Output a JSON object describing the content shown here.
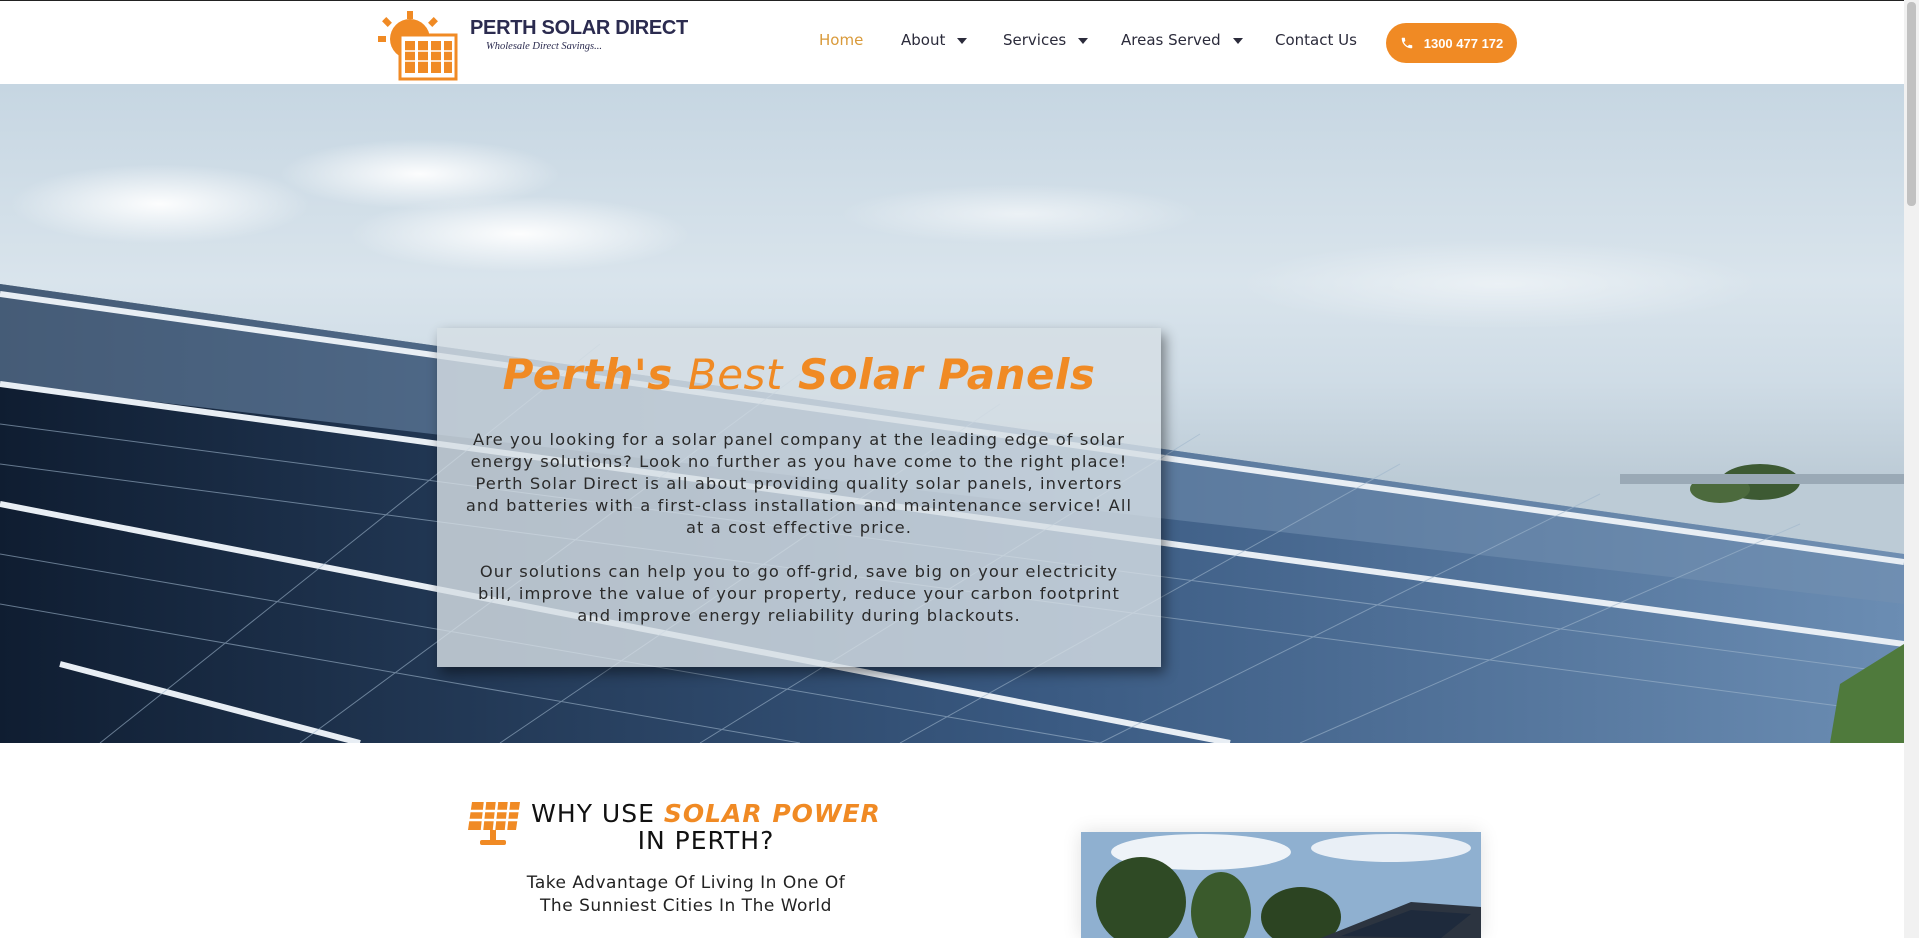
{
  "brand": {
    "name": "PERTH SOLAR DIRECT",
    "tagline": "Wholesale Direct Savings...",
    "accent_color": "#f08a24",
    "logo_icon": "sun-panel-logo-icon"
  },
  "nav": {
    "items": [
      {
        "label": "Home",
        "active": true,
        "dropdown": false
      },
      {
        "label": "About",
        "active": false,
        "dropdown": true
      },
      {
        "label": "Services",
        "active": false,
        "dropdown": true
      },
      {
        "label": "Areas Served",
        "active": false,
        "dropdown": true
      },
      {
        "label": "Contact Us",
        "active": false,
        "dropdown": false
      }
    ],
    "phone": {
      "label": "1300 477 172",
      "icon": "phone-icon"
    }
  },
  "hero": {
    "title_part1": "Perth's",
    "title_part2": "Best",
    "title_part3": "Solar Panels",
    "paragraph1": "Are you looking for a solar panel company at the leading edge of solar energy solutions? Look no further as you have come to the right place! Perth Solar Direct is all about providing quality solar panels, invertors and batteries with a first-class installation and maintenance service! All at a cost effective price.",
    "paragraph2": "Our solutions can help you to go off-grid, save big on your electricity bill, improve the value of your property, reduce your carbon footprint and improve energy reliability during blackouts."
  },
  "why": {
    "icon": "solar-panel-icon",
    "title_pre": "WHY USE",
    "title_highlight": "SOLAR POWER",
    "title_post": "IN PERTH?",
    "subtitle_line1": "Take Advantage Of Living In One Of",
    "subtitle_line2": "The Sunniest Cities In The World"
  }
}
